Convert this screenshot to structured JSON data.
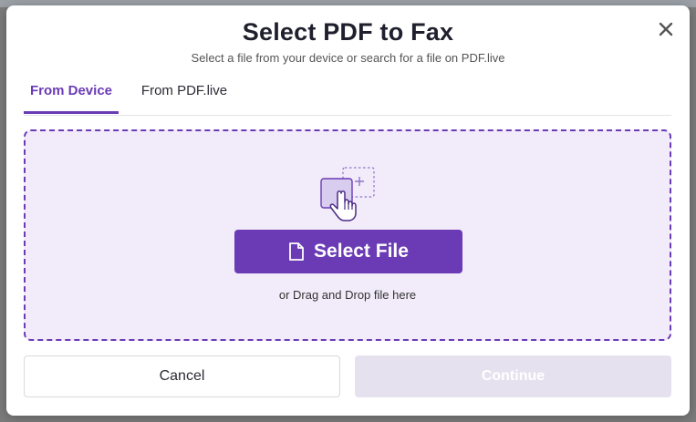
{
  "dialog": {
    "title": "Select PDF to Fax",
    "subtitle": "Select a file from your device or search for a file on PDF.live",
    "close_icon": "close-icon"
  },
  "tabs": [
    {
      "label": "From Device",
      "active": true
    },
    {
      "label": "From PDF.live",
      "active": false
    }
  ],
  "dropzone": {
    "icon": "hand-pointer-select-icon",
    "select_button_label": "Select File",
    "select_button_icon": "file-icon",
    "drag_hint": "or Drag and Drop file here"
  },
  "actions": {
    "cancel_label": "Cancel",
    "continue_label": "Continue",
    "continue_disabled": true
  },
  "colors": {
    "accent": "#6a3bb5",
    "dropzone_bg": "#f2ecfa",
    "disabled_bg": "#e6e1ef"
  }
}
